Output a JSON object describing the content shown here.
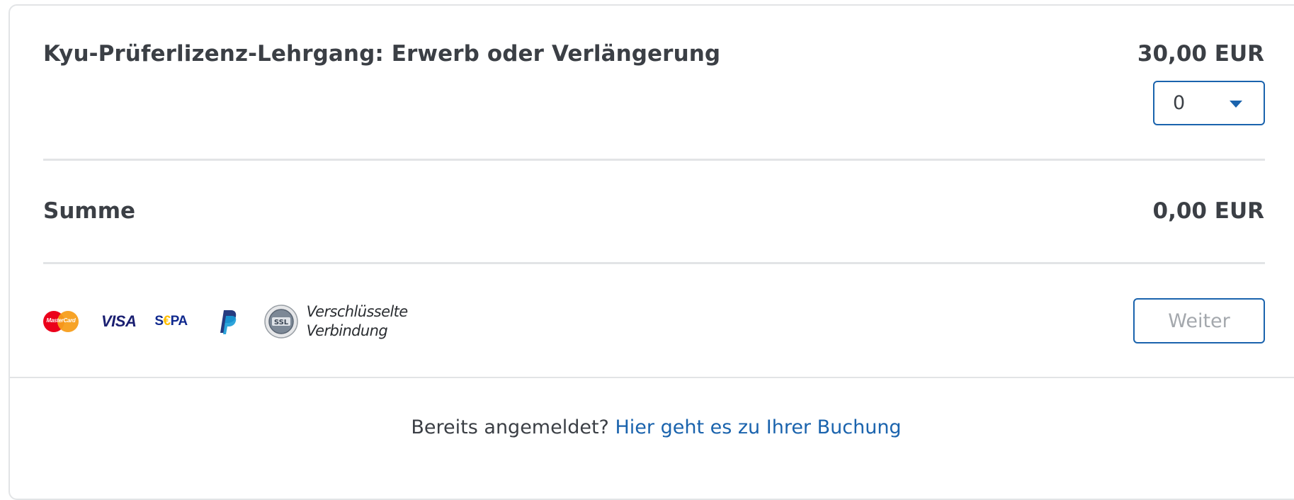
{
  "product": {
    "title": "Kyu-Prüferlizenz-Lehrgang: Erwerb oder Verlängerung",
    "price": "30,00 EUR",
    "quantity": "0"
  },
  "summary": {
    "label": "Summe",
    "total": "0,00 EUR"
  },
  "payment": {
    "mastercard_text": "MasterCard",
    "visa_text": "VISA",
    "sepa_prefix": "S",
    "sepa_euro": "€",
    "sepa_suffix": "PA",
    "ssl_badge_text": "SSL",
    "ssl_line1": "Verschlüsselte",
    "ssl_line2": "Verbindung"
  },
  "actions": {
    "next_label": "Weiter"
  },
  "footer": {
    "prompt": "Bereits angemeldet?",
    "link": "Hier geht es zu Ihrer Buchung"
  },
  "colors": {
    "accent": "#1a63ad",
    "text": "#3b3f45",
    "divider": "#e2e4e6",
    "disabled_text": "#a4a8ad"
  }
}
